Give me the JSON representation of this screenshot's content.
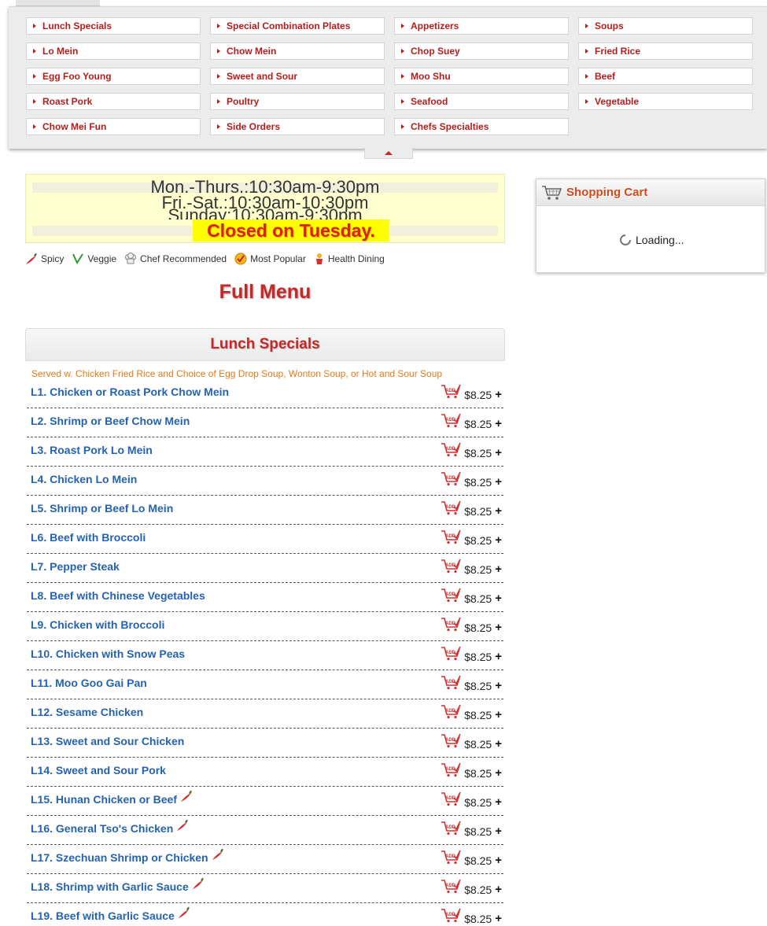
{
  "categories": [
    "Lunch Specials",
    "Special Combination Plates",
    "Appetizers",
    "Soups",
    "Lo Mein",
    "Chow Mein",
    "Chop Suey",
    "Fried Rice",
    "Egg Foo Young",
    "Sweet and Sour",
    "Moo Shu",
    "Beef",
    "Roast Pork",
    "Poultry",
    "Seafood",
    "Vegetable",
    "Chow Mei Fun",
    "Side Orders",
    "Chefs Specialties"
  ],
  "hours": {
    "line1": "Mon.-Thurs.:10:30am-9:30pm",
    "line2": "Fri.-Sat.:10:30am-10:30pm",
    "line3": "Sunday:10:30am-9:30pm",
    "closed": "Closed on Tuesday."
  },
  "legend": {
    "spicy": "Spicy",
    "veggie": "Veggie",
    "chef": "Chef Recommended",
    "popular": "Most Popular",
    "health": "Health Dining"
  },
  "page_title": "Full Menu",
  "section": {
    "title": "Lunch Specials",
    "description": "Served w. Chicken Fried Rice and Choice of Egg Drop Soup, Wonton Soup, or Hot and Sour Soup",
    "items": [
      {
        "name": "L1. Chicken or Roast Pork Chow Mein",
        "price": "$8.25",
        "spicy": false
      },
      {
        "name": "L2. Shrimp or Beef Chow Mein",
        "price": "$8.25",
        "spicy": false
      },
      {
        "name": "L3. Roast Pork Lo Mein",
        "price": "$8.25",
        "spicy": false
      },
      {
        "name": "L4. Chicken Lo Mein",
        "price": "$8.25",
        "spicy": false
      },
      {
        "name": "L5. Shrimp or Beef Lo Mein",
        "price": "$8.25",
        "spicy": false
      },
      {
        "name": "L6. Beef with Broccoli",
        "price": "$8.25",
        "spicy": false
      },
      {
        "name": "L7. Pepper Steak",
        "price": "$8.25",
        "spicy": false
      },
      {
        "name": "L8. Beef with Chinese Vegetables",
        "price": "$8.25",
        "spicy": false
      },
      {
        "name": "L9. Chicken with Broccoli",
        "price": "$8.25",
        "spicy": false
      },
      {
        "name": "L10. Chicken with Snow Peas",
        "price": "$8.25",
        "spicy": false
      },
      {
        "name": "L11. Moo Goo Gai Pan",
        "price": "$8.25",
        "spicy": false
      },
      {
        "name": "L12. Sesame Chicken",
        "price": "$8.25",
        "spicy": false
      },
      {
        "name": "L13. Sweet and Sour Chicken",
        "price": "$8.25",
        "spicy": false
      },
      {
        "name": "L14. Sweet and Sour Pork",
        "price": "$8.25",
        "spicy": false
      },
      {
        "name": "L15. Hunan Chicken or Beef",
        "price": "$8.25",
        "spicy": true
      },
      {
        "name": "L16. General Tso's Chicken",
        "price": "$8.25",
        "spicy": true
      },
      {
        "name": "L17. Szechuan Shrimp or Chicken",
        "price": "$8.25",
        "spicy": true
      },
      {
        "name": "L18. Shrimp with Garlic Sauce",
        "price": "$8.25",
        "spicy": true
      },
      {
        "name": "L19. Beef with Garlic Sauce",
        "price": "$8.25",
        "spicy": true
      }
    ]
  },
  "add_label": "ADD",
  "plus_label": "+",
  "cart": {
    "title": "Shopping Cart",
    "loading": "Loading..."
  },
  "colors": {
    "accent_red": "#c62828",
    "link_blue": "#2563b0",
    "note_orange": "#e07b1a",
    "closed_bg": "#ffff00"
  }
}
